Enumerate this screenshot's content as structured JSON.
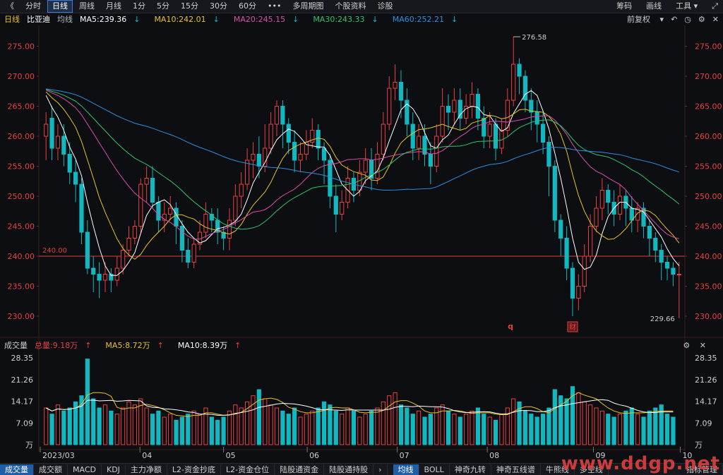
{
  "toolbar": {
    "collapse_icon": "chevron-left-icon",
    "tabs": [
      "分时",
      "日线",
      "周线",
      "月线",
      "1分",
      "5分",
      "15分",
      "30分",
      "60分",
      "•••",
      "多周期图",
      "个股资料",
      "诊股"
    ],
    "active_tab": "日线",
    "right_buttons": [
      "筹码",
      "画线",
      "工具"
    ]
  },
  "info": {
    "period": "日线",
    "stock_name": "比亚迪",
    "ma_label": "均线",
    "ma5": "MA5:239.36",
    "ma10": "MA10:242.01",
    "ma20": "MA20:245.15",
    "ma30": "MA30:243.33",
    "ma60": "MA60:252.21",
    "adjust": "前复权"
  },
  "indicator": {
    "title": "成交量",
    "total": "总量:9.18万",
    "ma5": "MA5:8.72万",
    "ma10": "MA10:8.39万"
  },
  "annotations": {
    "high": "276.58",
    "low": "229.66",
    "hline_label": "240.00",
    "marker_q": "q",
    "marker_fin": "财"
  },
  "bottom_tabs": {
    "left": [
      "成交量",
      "成交额",
      "MACD",
      "KDJ",
      "主力净额",
      "L2-资金抄底",
      "L2-资金仓位",
      "陆股通资金",
      "陆股通持股"
    ],
    "active_left": "成交量",
    "right": [
      "均线",
      "BOLL",
      "神奇九转",
      "神奇五线谱",
      "牛熊线",
      "多空线",
      "指标管理"
    ],
    "active_right": "均线"
  },
  "watermark": "www.ddgp.net",
  "colors": {
    "up": "#e8403f",
    "down": "#12b8c0",
    "ma5": "#ffffff",
    "ma10": "#e6c229",
    "ma20": "#d94fa7",
    "ma30": "#2fc46a",
    "ma60": "#2b8fe0",
    "hline": "#d9403a"
  },
  "chart_data": {
    "type": "candlestick",
    "price_axis": {
      "ticks": [
        230.0,
        235.0,
        240.0,
        245.0,
        250.0,
        255.0,
        260.0,
        265.0,
        270.0,
        275.0
      ],
      "ylim": [
        228,
        278
      ]
    },
    "volume_axis": {
      "ticks": [
        "28.35",
        "21.26",
        "14.17",
        "7.09",
        "万"
      ],
      "ylim": [
        0,
        30
      ]
    },
    "x_labels": [
      "2023/03",
      "04",
      "05",
      "06",
      "07",
      "08",
      "09",
      "10"
    ],
    "candles": [
      [
        260,
        262,
        256,
        264
      ],
      [
        263,
        258,
        256,
        265
      ],
      [
        258,
        260,
        256,
        262
      ],
      [
        260,
        257,
        255,
        262
      ],
      [
        257,
        254,
        252,
        259
      ],
      [
        254,
        252,
        249,
        256
      ],
      [
        252,
        244,
        242,
        253
      ],
      [
        244,
        238,
        237,
        246
      ],
      [
        238,
        237,
        234,
        240
      ],
      [
        237,
        236,
        233,
        239
      ],
      [
        236,
        237,
        234,
        239
      ],
      [
        237,
        236,
        234,
        238
      ],
      [
        236,
        238,
        235,
        240
      ],
      [
        238,
        241,
        237,
        242
      ],
      [
        241,
        243,
        240,
        245
      ],
      [
        243,
        245,
        242,
        246
      ],
      [
        245,
        252,
        244,
        253
      ],
      [
        252,
        253,
        249,
        255
      ],
      [
        253,
        249,
        248,
        255
      ],
      [
        249,
        246,
        244,
        250
      ],
      [
        246,
        247,
        244,
        249
      ],
      [
        247,
        248,
        246,
        250
      ],
      [
        248,
        245,
        242,
        249
      ],
      [
        245,
        241,
        239,
        246
      ],
      [
        241,
        239,
        238,
        243
      ],
      [
        239,
        242,
        238,
        243
      ],
      [
        242,
        244,
        241,
        246
      ],
      [
        244,
        247,
        243,
        249
      ],
      [
        247,
        246,
        244,
        248
      ],
      [
        246,
        244,
        242,
        248
      ],
      [
        244,
        243,
        241,
        245
      ],
      [
        243,
        246,
        241,
        248
      ],
      [
        246,
        250,
        245,
        252
      ],
      [
        250,
        252,
        248,
        254
      ],
      [
        252,
        256,
        251,
        258
      ],
      [
        256,
        257,
        253,
        259
      ],
      [
        257,
        255,
        253,
        260
      ],
      [
        255,
        258,
        254,
        262
      ],
      [
        258,
        262,
        257,
        264
      ],
      [
        262,
        265,
        260,
        266
      ],
      [
        265,
        262,
        258,
        266
      ],
      [
        262,
        259,
        257,
        263
      ],
      [
        259,
        256,
        254,
        261
      ],
      [
        256,
        257,
        254,
        259
      ],
      [
        257,
        259,
        256,
        261
      ],
      [
        259,
        261,
        258,
        263
      ],
      [
        261,
        258,
        256,
        262
      ],
      [
        258,
        256,
        252,
        259
      ],
      [
        256,
        250,
        248,
        257
      ],
      [
        250,
        247,
        244,
        252
      ],
      [
        247,
        249,
        246,
        251
      ],
      [
        249,
        253,
        248,
        255
      ],
      [
        253,
        251,
        249,
        254
      ],
      [
        251,
        254,
        250,
        256
      ],
      [
        254,
        256,
        252,
        258
      ],
      [
        256,
        253,
        251,
        258
      ],
      [
        253,
        257,
        252,
        259
      ],
      [
        257,
        262,
        256,
        264
      ],
      [
        262,
        268,
        261,
        270
      ],
      [
        268,
        269,
        266,
        272
      ],
      [
        269,
        266,
        263,
        271
      ],
      [
        266,
        262,
        260,
        268
      ],
      [
        262,
        258,
        256,
        264
      ],
      [
        258,
        260,
        256,
        262
      ],
      [
        260,
        257,
        255,
        262
      ],
      [
        257,
        255,
        252,
        259
      ],
      [
        255,
        260,
        254,
        262
      ],
      [
        260,
        265,
        259,
        268
      ],
      [
        265,
        264,
        261,
        267
      ],
      [
        264,
        266,
        262,
        268
      ],
      [
        266,
        263,
        261,
        268
      ],
      [
        263,
        265,
        262,
        267
      ],
      [
        265,
        267,
        263,
        269
      ],
      [
        267,
        263,
        261,
        268
      ],
      [
        263,
        260,
        258,
        265
      ],
      [
        260,
        262,
        258,
        264
      ],
      [
        262,
        258,
        256,
        263
      ],
      [
        258,
        261,
        257,
        263
      ],
      [
        261,
        266,
        260,
        268
      ],
      [
        266,
        272,
        265,
        276.58
      ],
      [
        272,
        270,
        267,
        273
      ],
      [
        270,
        266,
        264,
        271
      ],
      [
        266,
        264,
        261,
        268
      ],
      [
        264,
        262,
        259,
        266
      ],
      [
        262,
        259,
        257,
        264
      ],
      [
        259,
        255,
        250,
        260
      ],
      [
        255,
        246,
        244,
        256
      ],
      [
        246,
        243,
        240,
        247
      ],
      [
        243,
        238,
        236,
        245
      ],
      [
        238,
        233,
        230,
        239
      ],
      [
        233,
        235,
        231,
        237
      ],
      [
        235,
        240,
        234,
        242
      ],
      [
        240,
        245,
        239,
        247
      ],
      [
        245,
        248,
        244,
        250
      ],
      [
        248,
        251,
        246,
        253
      ],
      [
        251,
        249,
        247,
        252
      ],
      [
        249,
        247,
        245,
        251
      ],
      [
        247,
        250,
        246,
        252
      ],
      [
        250,
        248,
        245,
        251
      ],
      [
        248,
        246,
        244,
        250
      ],
      [
        246,
        248,
        244,
        249
      ],
      [
        248,
        245,
        243,
        249
      ],
      [
        245,
        243,
        240,
        246
      ],
      [
        243,
        241,
        239,
        244
      ],
      [
        241,
        239,
        236,
        242
      ],
      [
        239,
        238,
        236,
        240
      ],
      [
        238,
        237,
        235,
        239
      ],
      [
        237,
        237,
        229.66,
        239
      ]
    ],
    "volumes": [
      12,
      10,
      13,
      11,
      12,
      14,
      16,
      28,
      15,
      12,
      13,
      11,
      10,
      12,
      14,
      13,
      15,
      12,
      10,
      11,
      9,
      10,
      8,
      9,
      10,
      11,
      10,
      12,
      9,
      8,
      9,
      11,
      13,
      12,
      14,
      16,
      18,
      15,
      13,
      12,
      11,
      10,
      12,
      9,
      10,
      11,
      12,
      14,
      13,
      11,
      10,
      12,
      11,
      9,
      10,
      11,
      12,
      14,
      16,
      17,
      13,
      12,
      10,
      11,
      9,
      10,
      12,
      13,
      11,
      10,
      9,
      10,
      11,
      12,
      10,
      9,
      8,
      10,
      12,
      15,
      14,
      11,
      10,
      9,
      10,
      12,
      18,
      16,
      15,
      19,
      17,
      14,
      13,
      12,
      11,
      10,
      9,
      10,
      11,
      12,
      10,
      9,
      11,
      12,
      13,
      10,
      9
    ]
  }
}
